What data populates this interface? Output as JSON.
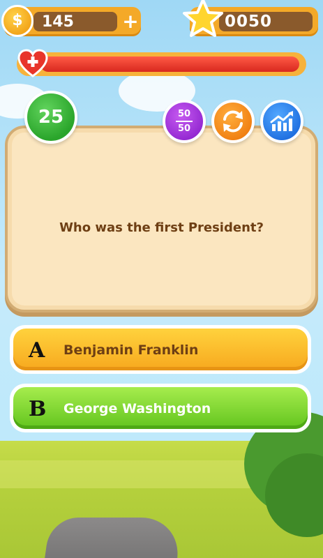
{
  "hud": {
    "coins": "145",
    "coin_symbol": "$",
    "add_label": "+",
    "score": "0050",
    "health_level": 1.0
  },
  "lifelines": {
    "timer": "25",
    "fifty_top": "50",
    "fifty_bottom": "50",
    "icons": [
      "fifty-fifty-icon",
      "swap-question-icon",
      "audience-stats-icon"
    ]
  },
  "question": {
    "text": "Who was the first President?"
  },
  "answers": [
    {
      "letter": "A",
      "text": "Benjamin Franklin",
      "color": "#f7a81e"
    },
    {
      "letter": "B",
      "text": "George Washington",
      "color": "#62c41e"
    }
  ]
}
